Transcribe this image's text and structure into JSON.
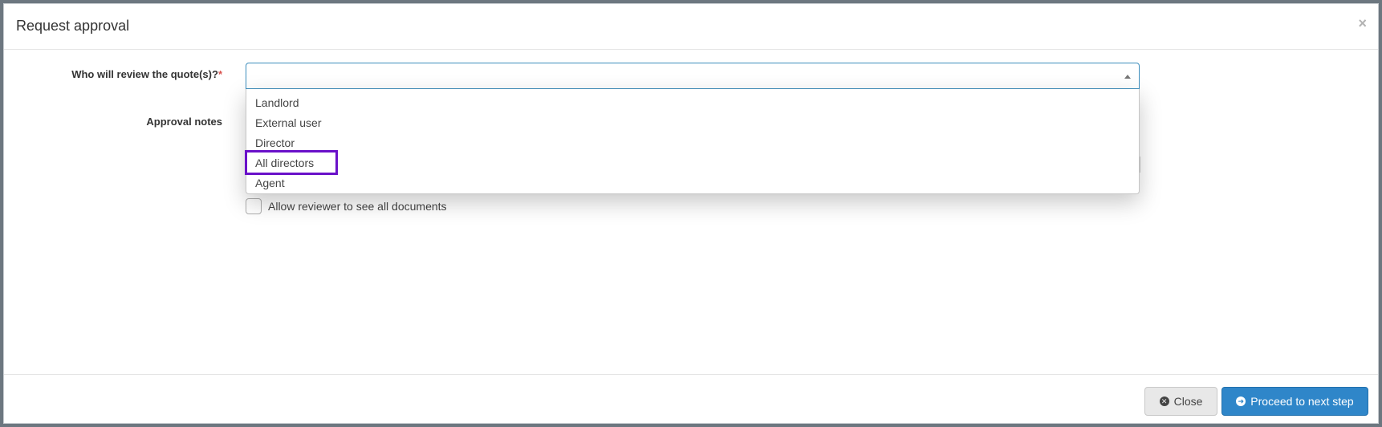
{
  "modal": {
    "title": "Request approval",
    "close_symbol": "×"
  },
  "form": {
    "reviewer_label": "Who will review the quote(s)?",
    "required_mark": "*",
    "notes_label": "Approval notes",
    "reviewer_select": {
      "value": "",
      "options": [
        "Landlord",
        "External user",
        "Director",
        "All directors",
        "Agent"
      ],
      "highlighted_option": "All directors"
    },
    "allow_docs_label": "Allow reviewer to see all documents",
    "allow_docs_checked": false
  },
  "footer": {
    "close_label": "Close",
    "next_label": "Proceed to next step"
  },
  "icons": {
    "close_button_icon": "times-circle-icon",
    "next_button_icon": "arrow-circle-right-icon",
    "select_icon": "caret-up-icon"
  },
  "colors": {
    "primary": "#2f86c9",
    "highlight": "#6a11c9",
    "required": "#d9534f"
  }
}
